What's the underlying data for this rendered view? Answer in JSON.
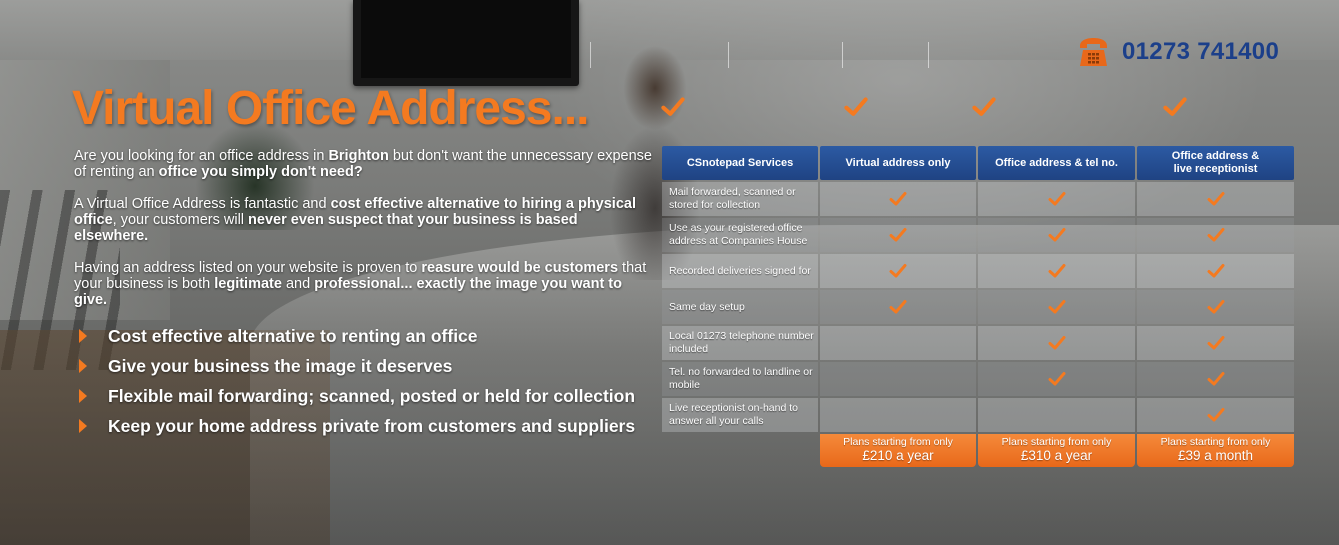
{
  "phone": {
    "number": "01273 741400",
    "icon": "telephone-icon"
  },
  "hero": {
    "title": "Virtual Office Address...",
    "paragraphs": [
      [
        {
          "t": "Are you looking for an office address in ",
          "b": false
        },
        {
          "t": "Brighton",
          "b": true
        },
        {
          "t": " but don't want the unnecessary expense of renting an ",
          "b": false
        },
        {
          "t": "office you simply don't need?",
          "b": true
        }
      ],
      [
        {
          "t": "A Virtual Office Address is fantastic and ",
          "b": false
        },
        {
          "t": "cost effective alternative to hiring a physical office",
          "b": true
        },
        {
          "t": ", your customers will ",
          "b": false
        },
        {
          "t": "never even suspect that your business is based elsewhere.",
          "b": true
        }
      ],
      [
        {
          "t": "Having an address listed on your website is proven to ",
          "b": false
        },
        {
          "t": "reasure would be customers",
          "b": true
        },
        {
          "t": " that your business is both ",
          "b": false
        },
        {
          "t": "legitimate",
          "b": true
        },
        {
          "t": " and ",
          "b": false
        },
        {
          "t": "professional... exactly the image you want to give.",
          "b": true
        }
      ]
    ],
    "bullets": [
      "Cost effective alternative to renting an office",
      "Give your business the image it deserves",
      "Flexible mail forwarding; scanned, posted or held for collection",
      "Keep your home address private from customers and suppliers"
    ]
  },
  "table": {
    "headers": [
      "CSnotepad Services",
      "Virtual address only",
      "Office address & tel no.",
      "Office address &\nlive receptionist"
    ],
    "rows": [
      {
        "label": "Mail forwarded, scanned or stored for collection",
        "checks": [
          true,
          true,
          true
        ]
      },
      {
        "label": "Use as your registered office address at Companies House",
        "checks": [
          true,
          true,
          true
        ]
      },
      {
        "label": "Recorded deliveries signed for",
        "checks": [
          true,
          true,
          true
        ]
      },
      {
        "label": "Same day setup",
        "checks": [
          true,
          true,
          true
        ]
      },
      {
        "label": "Local 01273 telephone number included",
        "checks": [
          false,
          true,
          true
        ]
      },
      {
        "label": "Tel. no forwarded to landline or mobile",
        "checks": [
          false,
          true,
          true
        ]
      },
      {
        "label": "Live receptionist on-hand to answer all your calls",
        "checks": [
          false,
          false,
          true
        ]
      }
    ],
    "plans": [
      {
        "sub": "Plans starting from only",
        "price": "£210 a year"
      },
      {
        "sub": "Plans starting from only",
        "price": "£310 a year"
      },
      {
        "sub": "Plans starting from only",
        "price": "£39 a month"
      }
    ]
  },
  "colors": {
    "accent": "#f47a20",
    "header_blue": "#1f4383",
    "phone_blue": "#1b3f8a"
  }
}
